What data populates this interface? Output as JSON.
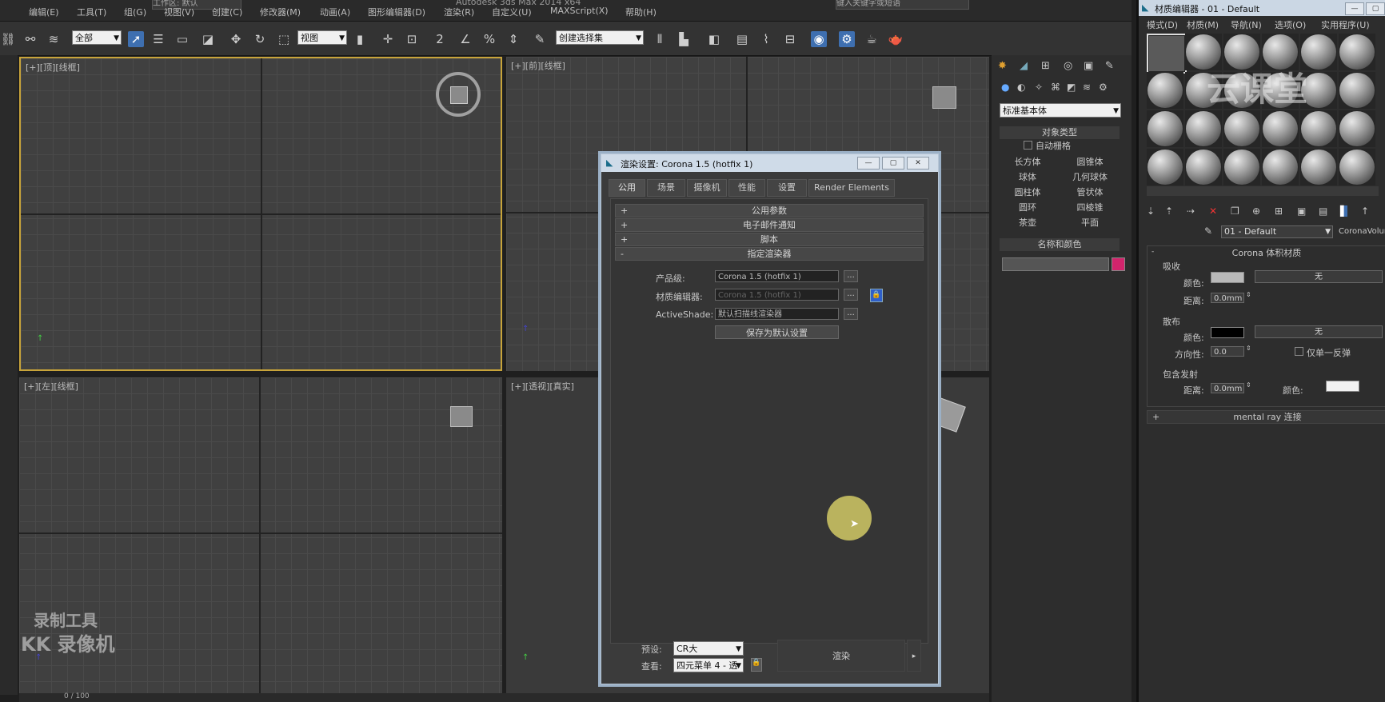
{
  "menubar": {
    "app_title": "Autodesk 3ds Max 2014 x64",
    "workspace": "工作区: 默认",
    "search_placeholder": "键入关键字或短语",
    "items": [
      "编辑(E)",
      "工具(T)",
      "组(G)",
      "视图(V)",
      "创建(C)",
      "修改器(M)",
      "动画(A)",
      "图形编辑器(D)",
      "渲染(R)",
      "自定义(U)",
      "MAXScript(X)",
      "帮助(H)"
    ]
  },
  "toolbar": {
    "selection_filter": "全部",
    "ref_coord": "视图",
    "named_selection": "创建选择集"
  },
  "viewports": {
    "top": "[+][顶][线框]",
    "front": "[+][前][线框]",
    "left": "[+][左][线框]",
    "perspective": "[+][透视][真实]"
  },
  "command_panel": {
    "category": "标准基本体",
    "object_type_header": "对象类型",
    "autogrid": "自动栅格",
    "objects": [
      "长方体",
      "圆锥体",
      "球体",
      "几何球体",
      "圆柱体",
      "管状体",
      "圆环",
      "四棱锥",
      "茶壶",
      "平面"
    ],
    "name_color_header": "名称和颜色",
    "object_color": "#d2246c"
  },
  "render_dialog": {
    "title": "渲染设置: Corona 1.5 (hotfix 1)",
    "tabs": [
      "公用",
      "场景",
      "摄像机",
      "性能",
      "设置",
      "Render Elements"
    ],
    "rollouts": [
      {
        "sign": "+",
        "label": "公用参数"
      },
      {
        "sign": "+",
        "label": "电子邮件通知"
      },
      {
        "sign": "+",
        "label": "脚本"
      },
      {
        "sign": "-",
        "label": "指定渲染器"
      }
    ],
    "production_label": "产品级:",
    "production_value": "Corona 1.5 (hotfix 1)",
    "mat_editor_label": "材质编辑器:",
    "mat_editor_value": "Corona 1.5 (hotfix 1)",
    "activeshade_label": "ActiveShade:",
    "activeshade_value": "默认扫描线渲染器",
    "save_default": "保存为默认设置",
    "preset_label": "预设:",
    "preset_value": "CR大",
    "view_label": "查看:",
    "view_value": "四元菜单 4 - 透",
    "render_button": "渲染"
  },
  "material_editor": {
    "title": "材质编辑器 - 01 - Default",
    "menu": [
      "模式(D)",
      "材质(M)",
      "导航(N)",
      "选项(O)",
      "实用程序(U)"
    ],
    "material_name": "01 - Default",
    "material_type": "CoronaVolume",
    "rollout_title": "Corona 体积材质",
    "absorption_header": "吸收",
    "absorption_color_label": "颜色:",
    "absorption_map": "无",
    "absorption_dist_label": "距离:",
    "absorption_dist": "0.0mm",
    "absorption_color": "#b9b9b9",
    "scatter_header": "散布",
    "scatter_color_label": "颜色:",
    "scatter_map": "无",
    "scatter_dir_label": "方向性:",
    "scatter_dir": "0.0",
    "single_bounce": "仅单一反弹",
    "scatter_color": "#000000",
    "emission_header": "包含发射",
    "emission_dist_label": "距离:",
    "emission_dist": "0.0mm",
    "emission_color_label": "颜色:",
    "emission_color": "#f2f2f2",
    "mentalray_rollout": "mental ray 连接"
  },
  "status": {
    "frame_counter": "0 / 100"
  },
  "watermarks": {
    "recorder_line1": "录制工具",
    "recorder_line2": "KK 录像机",
    "brand": "云课堂"
  }
}
